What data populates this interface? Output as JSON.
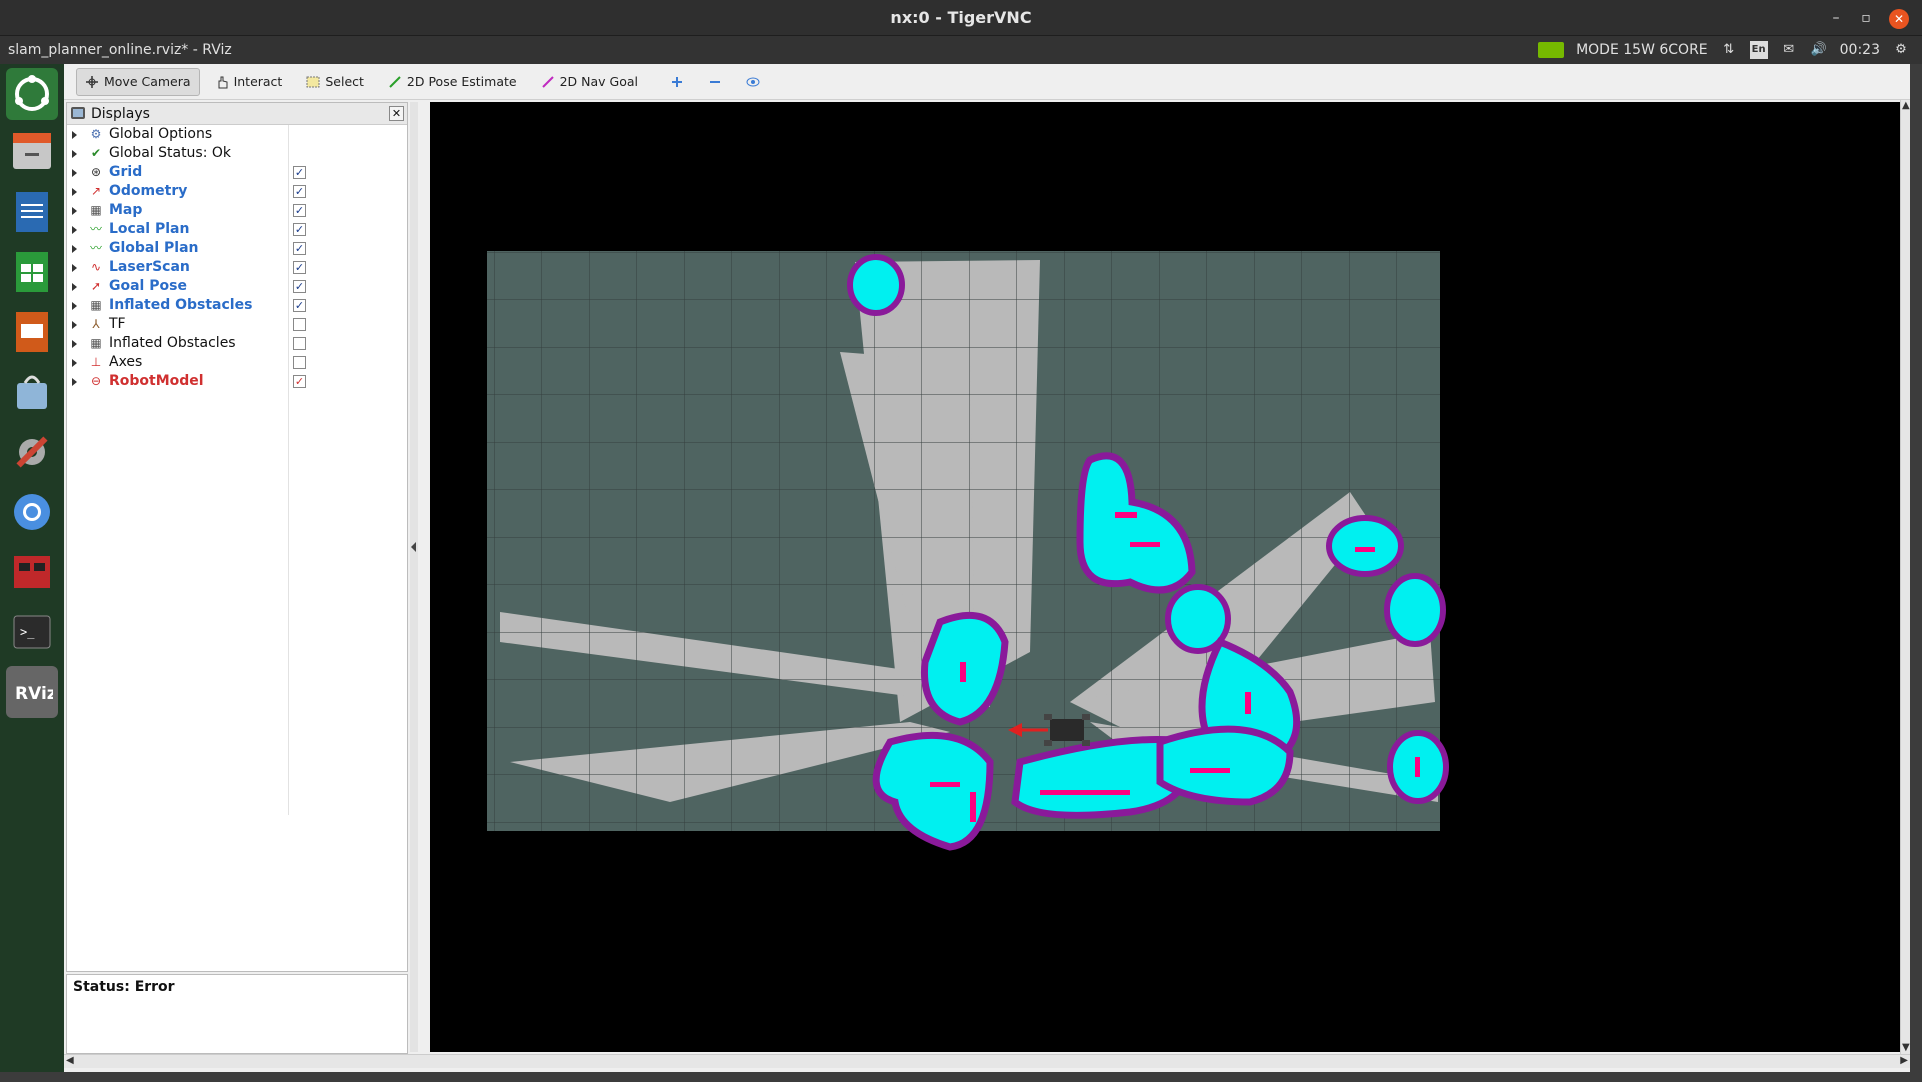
{
  "window": {
    "title": "nx:0 - TigerVNC"
  },
  "panel": {
    "app_title": "slam_planner_online.rviz* - RViz",
    "nvidia_mode": "MODE 15W 6CORE",
    "keyboard": "En",
    "clock": "00:23"
  },
  "launcher": {
    "items": [
      "ubuntu-home-icon",
      "files-icon",
      "writer-icon",
      "calc-icon",
      "impress-icon",
      "software-store-icon",
      "settings-icon",
      "chromium-icon",
      "multimedia-icon",
      "terminal-icon",
      "rviz-icon"
    ]
  },
  "toolbar": {
    "move_camera": "Move Camera",
    "interact": "Interact",
    "select": "Select",
    "pose_estimate": "2D Pose Estimate",
    "nav_goal": "2D Nav Goal"
  },
  "displays": {
    "title": "Displays",
    "items": [
      {
        "label": "Global Options",
        "style": "plain",
        "icon": "gear-icon",
        "checked": null
      },
      {
        "label": "Global Status: Ok",
        "style": "plain",
        "icon": "check-icon",
        "checked": null
      },
      {
        "label": "Grid",
        "style": "blue",
        "icon": "grid-icon",
        "checked": true
      },
      {
        "label": "Odometry",
        "style": "blue",
        "icon": "odometry-icon",
        "checked": true
      },
      {
        "label": "Map",
        "style": "blue",
        "icon": "map-icon",
        "checked": true
      },
      {
        "label": "Local Plan",
        "style": "blue",
        "icon": "path-icon",
        "checked": true
      },
      {
        "label": "Global Plan",
        "style": "blue",
        "icon": "path-icon",
        "checked": true
      },
      {
        "label": "LaserScan",
        "style": "blue",
        "icon": "laser-icon",
        "checked": true
      },
      {
        "label": "Goal Pose",
        "style": "blue",
        "icon": "pose-icon",
        "checked": true
      },
      {
        "label": "Inflated Obstacles",
        "style": "blue",
        "icon": "map-icon",
        "checked": true
      },
      {
        "label": "TF",
        "style": "plain",
        "icon": "tf-icon",
        "checked": false
      },
      {
        "label": "Inflated Obstacles",
        "style": "plain",
        "icon": "map-icon",
        "checked": false
      },
      {
        "label": "Axes",
        "style": "plain",
        "icon": "axes-icon",
        "checked": false
      },
      {
        "label": "RobotModel",
        "style": "red",
        "icon": "robot-icon",
        "checked": true
      }
    ]
  },
  "status": {
    "text": "Status: Error"
  },
  "colors": {
    "map_free": "#b9b9b9",
    "map_unknown": "#4f6461",
    "inflation_cyan": "#00f0f0",
    "inflation_border": "#7a1fa0",
    "obstacle_magenta": "#ff0080",
    "goal_arrow": "#e02020"
  }
}
